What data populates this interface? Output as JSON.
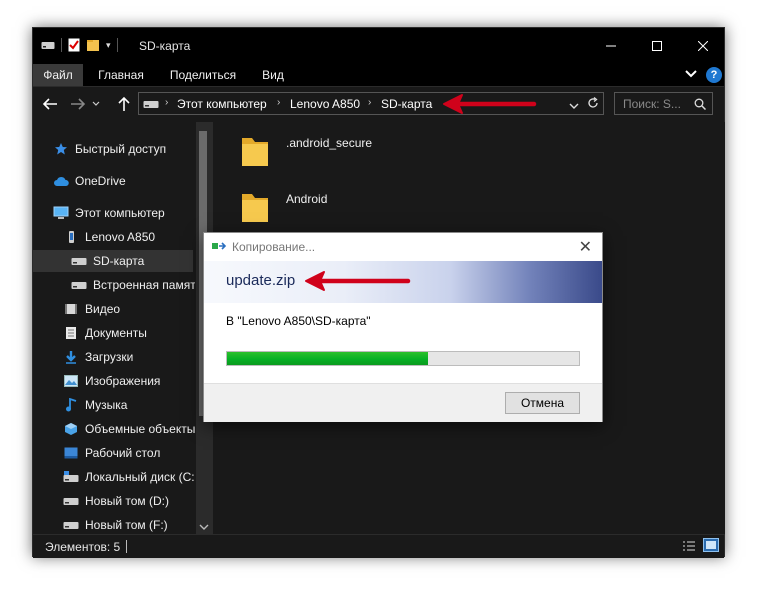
{
  "window": {
    "title": "SD-карта",
    "controls": [
      "minimize-icon",
      "maximize-icon",
      "close-icon"
    ]
  },
  "ribbon": {
    "tabs": [
      {
        "label": "Файл",
        "active": true
      },
      {
        "label": "Главная",
        "active": false
      },
      {
        "label": "Поделиться",
        "active": false
      },
      {
        "label": "Вид",
        "active": false
      }
    ]
  },
  "navigation": {
    "breadcrumbs": [
      "Этот компьютер",
      "Lenovo A850",
      "SD-карта"
    ],
    "search_placeholder": "Поиск: S..."
  },
  "sidebar": {
    "items": [
      {
        "label": "Быстрый доступ",
        "icon": "star-icon"
      },
      {
        "label": "OneDrive",
        "icon": "cloud-icon"
      },
      {
        "label": "Этот компьютер",
        "icon": "computer-icon"
      },
      {
        "label": "Lenovo A850",
        "icon": "phone-icon"
      },
      {
        "label": "SD-карта",
        "icon": "drive-icon",
        "selected": true
      },
      {
        "label": "Встроенная памяти",
        "icon": "drive-icon"
      },
      {
        "label": "Видео",
        "icon": "video-icon"
      },
      {
        "label": "Документы",
        "icon": "documents-icon"
      },
      {
        "label": "Загрузки",
        "icon": "downloads-icon"
      },
      {
        "label": "Изображения",
        "icon": "pictures-icon"
      },
      {
        "label": "Музыка",
        "icon": "music-icon"
      },
      {
        "label": "Объемные объекты",
        "icon": "3d-objects-icon"
      },
      {
        "label": "Рабочий стол",
        "icon": "desktop-icon"
      },
      {
        "label": "Локальный диск (C:",
        "icon": "local-disk-icon"
      },
      {
        "label": "Новый том (D:)",
        "icon": "drive-icon"
      },
      {
        "label": "Новый том (F:)",
        "icon": "drive-icon"
      }
    ]
  },
  "content": {
    "folders": [
      ".android_secure",
      "Android"
    ]
  },
  "status": {
    "items_count": "Элементов: 5"
  },
  "dialog": {
    "title": "Копирование...",
    "filename": "update.zip",
    "destination": "В \"Lenovo A850\\SD-карта\"",
    "progress": 0.57,
    "cancel_label": "Отмена"
  },
  "colors": {
    "arrow": "#d0021b",
    "progress": "#06b025"
  }
}
